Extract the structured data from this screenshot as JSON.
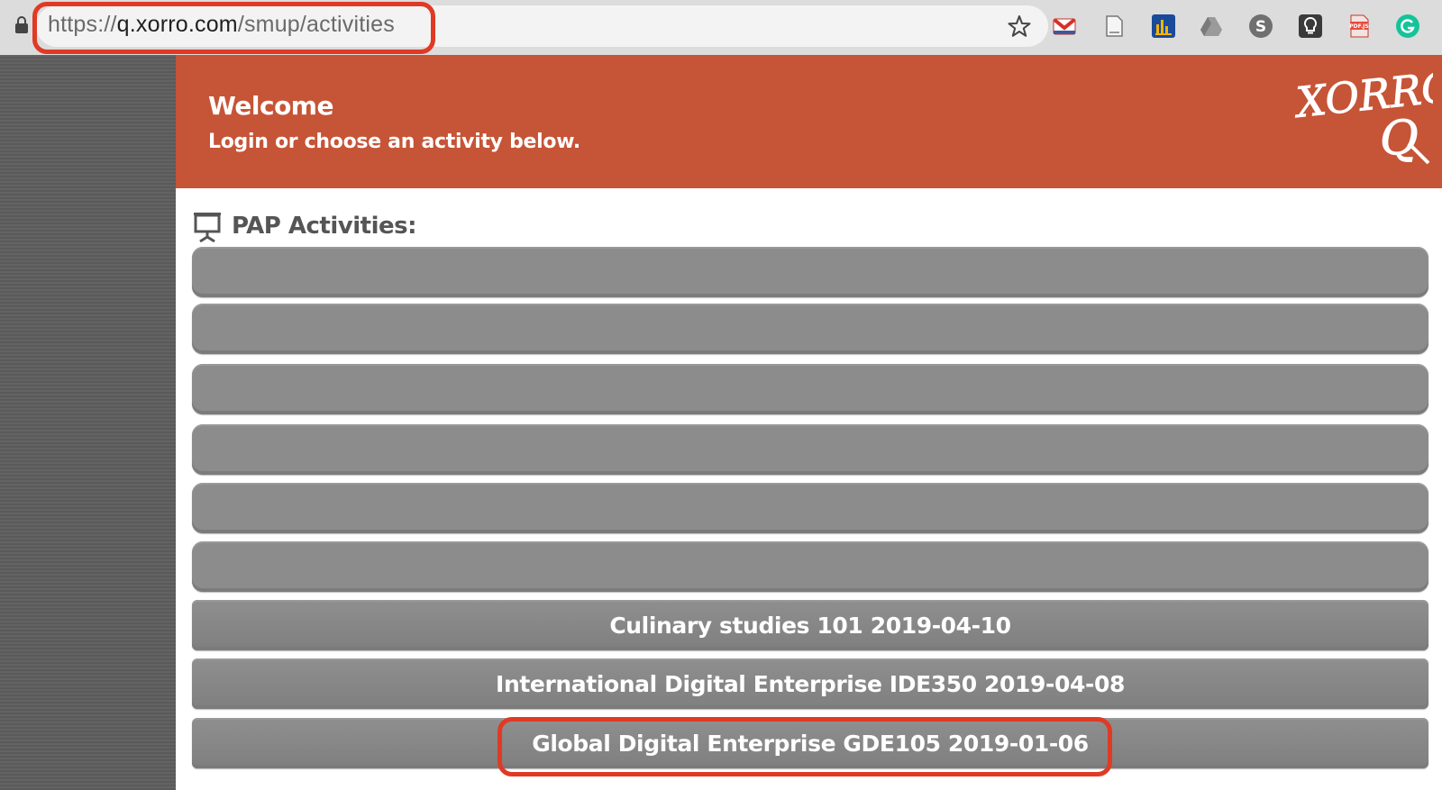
{
  "browser": {
    "url_scheme": "https://",
    "url_host": "q.xorro.com",
    "url_path": "/smup/activities",
    "highlight_color": "#e03a25",
    "extensions": [
      "gmail-icon",
      "document-icon",
      "analytics-icon",
      "drive-icon",
      "s-extension-icon",
      "lightbulb-icon",
      "pdf-js-icon",
      "grammarly-icon"
    ],
    "pdf_ext_label": "PDF.JS",
    "s_ext_label": "S"
  },
  "banner": {
    "welcome": "Welcome",
    "subtitle": "Login or choose an activity below.",
    "logo_top": "XORRO",
    "logo_bottom": "Q",
    "color": "#c65436"
  },
  "section": {
    "title": "PAP Activities:",
    "icon": "projector-icon"
  },
  "activities": [
    {
      "label": ""
    },
    {
      "label": ""
    },
    {
      "label": ""
    },
    {
      "label": ""
    },
    {
      "label": ""
    },
    {
      "label": ""
    },
    {
      "label": "Culinary studies 101 2019-04-10"
    },
    {
      "label": "International Digital Enterprise IDE350 2019-04-08"
    },
    {
      "label": "Global Digital Enterprise GDE105 2019-01-06"
    }
  ]
}
